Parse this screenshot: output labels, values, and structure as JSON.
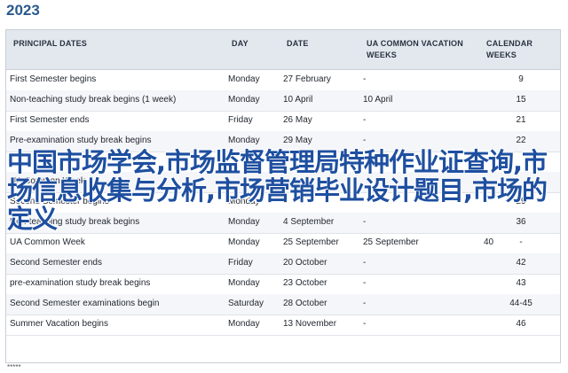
{
  "year": "2023",
  "headers": {
    "principal": "PRINCIPAL DATES",
    "day": "DAY",
    "date": "DATE",
    "ua": "UA COMMON VACATION WEEKS",
    "calendar": "CALENDAR WEEKS"
  },
  "rows": [
    {
      "event": "First Semester begins",
      "day": "Monday",
      "date": "27 February",
      "ua": "-",
      "ua_extra": "",
      "week": "9"
    },
    {
      "event": "Non-teaching study break begins (1 week)",
      "day": "Monday",
      "date": "10 April",
      "ua": "10 April",
      "ua_extra": "",
      "week": "15"
    },
    {
      "event": "First Semester ends",
      "day": "Friday",
      "date": "26 May",
      "ua": "-",
      "ua_extra": "",
      "week": "21"
    },
    {
      "event": "Pre-examination study break begins",
      "day": "Monday",
      "date": "29 May",
      "ua": "-",
      "ua_extra": "",
      "week": "22"
    },
    {
      "event": "",
      "day": "",
      "date": "",
      "ua": "",
      "ua_extra": "",
      "week": ""
    },
    {
      "event": "UA Common Week",
      "day": "",
      "date": "",
      "ua": "",
      "ua_extra": "",
      "week": ""
    },
    {
      "event": "Second Semester begins",
      "day": "Monday",
      "date": "",
      "ua": "",
      "ua_extra": "",
      "week": "29"
    },
    {
      "event": "Non-teaching study break begins",
      "day": "Monday",
      "date": "4 September",
      "ua": "-",
      "ua_extra": "",
      "week": "36"
    },
    {
      "event": "UA Common Week",
      "day": "Monday",
      "date": "25 September",
      "ua": "25 September",
      "ua_extra": "40",
      "week": "-"
    },
    {
      "event": "Second Semester ends",
      "day": "Friday",
      "date": "20 October",
      "ua": "-",
      "ua_extra": "",
      "week": "42"
    },
    {
      "event": "pre-examination study break begins",
      "day": "Monday",
      "date": "23 October",
      "ua": "-",
      "ua_extra": "",
      "week": "43"
    },
    {
      "event": "Second Semester examinations begin",
      "day": "Saturday",
      "date": "28 October",
      "ua": "-",
      "ua_extra": "",
      "week": "44-45"
    },
    {
      "event": "Summer Vacation begins",
      "day": "Monday",
      "date": "13 November",
      "ua": "-",
      "ua_extra": "",
      "week": "46"
    }
  ],
  "overlay_text": "中国市场学会,市场监督管理局特种作业证查询,市场信息收集与分析,市场营销毕业设计题目,市场的定义",
  "footnote": "*****"
}
